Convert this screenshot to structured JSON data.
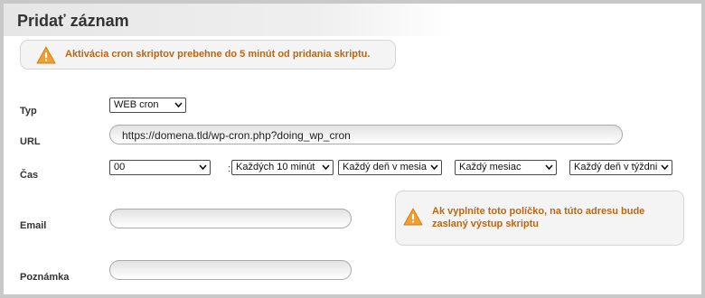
{
  "page": {
    "title": "Pridať záznam"
  },
  "notice": {
    "text": "Aktivácia cron skriptov prebehne do 5 minút od pridania skriptu."
  },
  "form": {
    "type": {
      "label": "Typ",
      "value": "WEB cron"
    },
    "url": {
      "label": "URL",
      "value": "https://domena.tld/wp-cron.php?doing_wp_cron"
    },
    "time": {
      "label": "Čas",
      "separator": ":",
      "minute": "00",
      "interval": "Každých 10 minút",
      "day_of_month": "Každý deň v mesia",
      "month": "Každý mesiac",
      "day_of_week": "Každý deň v týždni"
    },
    "email": {
      "label": "Email",
      "value": "",
      "hint": "Ak vyplníte toto políčko, na túto adresu bude zaslaný výstup skriptu"
    },
    "note": {
      "label": "Poznámka",
      "value": ""
    }
  },
  "colors": {
    "warning_text": "#c0650f",
    "warning_icon": "#f0a030",
    "panel_bg": "#ffffff",
    "outer_bg": "#c8c8c8"
  }
}
